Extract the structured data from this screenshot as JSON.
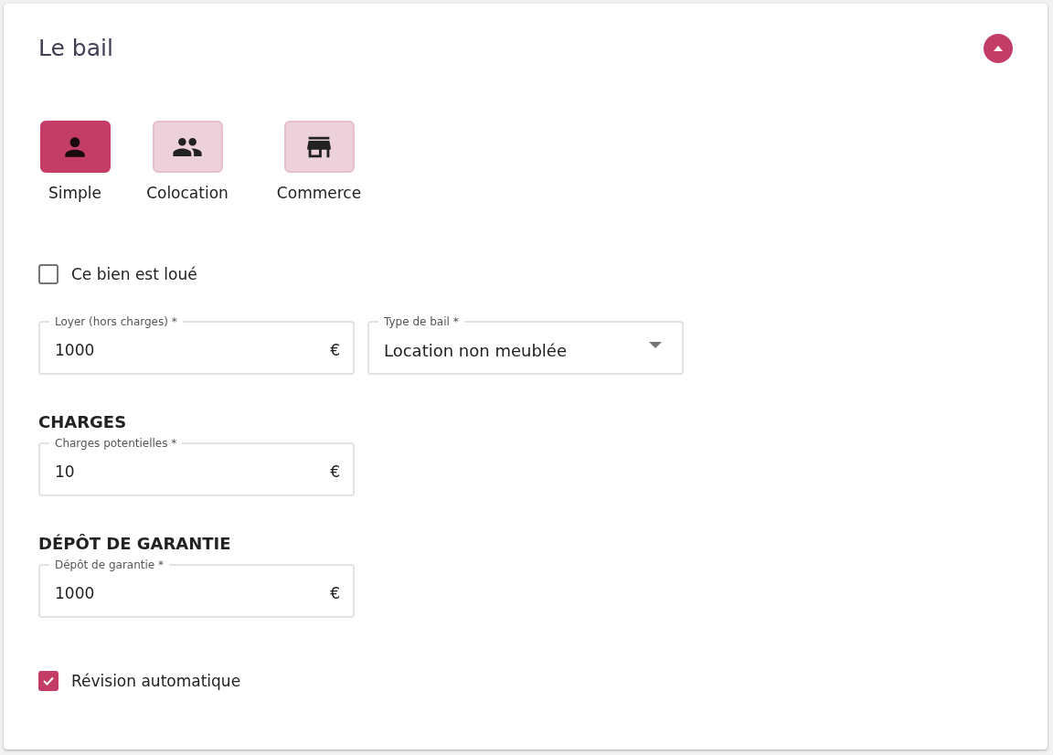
{
  "title": "Le bail",
  "expanded": true,
  "lease_types": [
    {
      "kind": "person",
      "label": "Simple",
      "selected": true
    },
    {
      "kind": "people",
      "label": "Colocation",
      "selected": false
    },
    {
      "kind": "store",
      "label": "Commerce",
      "selected": false
    }
  ],
  "rented": {
    "label": "Ce bien est loué",
    "checked": false
  },
  "rent": {
    "label": "Loyer (hors charges) *",
    "value": "1000",
    "unit": "€"
  },
  "lease_kind": {
    "label": "Type de bail *",
    "value": "Location non meublée"
  },
  "charges": {
    "heading": "CHARGES",
    "field": {
      "label": "Charges potentielles *",
      "value": "10",
      "unit": "€"
    }
  },
  "deposit": {
    "heading": "DÉPÔT DE GARANTIE",
    "field": {
      "label": "Dépôt de garantie *",
      "value": "1000",
      "unit": "€"
    }
  },
  "auto_revision": {
    "label": "Révision automatique",
    "checked": true
  }
}
